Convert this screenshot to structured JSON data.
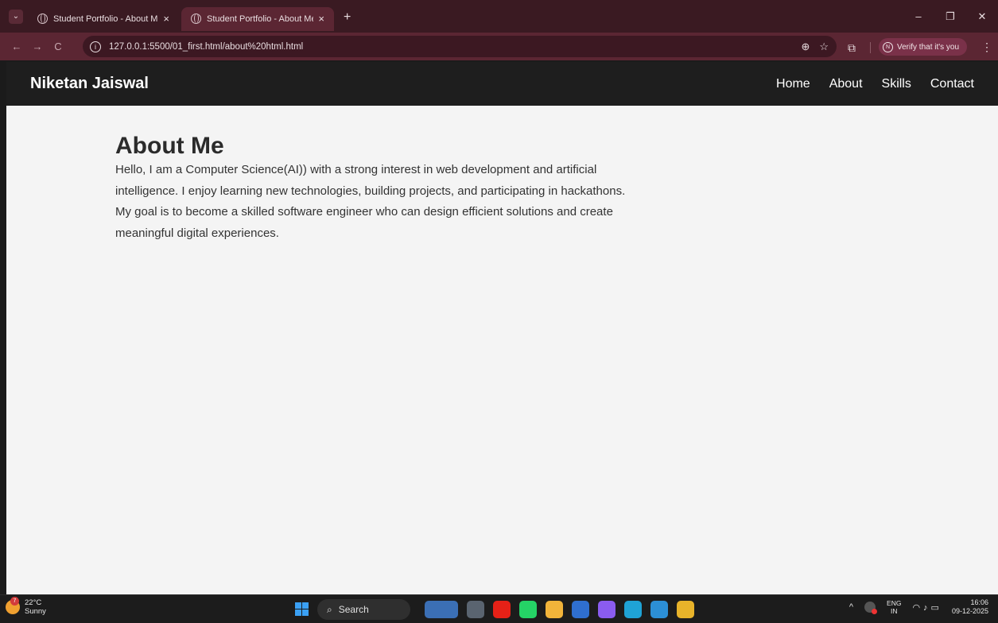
{
  "browser": {
    "tabs": [
      {
        "title": "Student Portfolio - About Me",
        "close": "×"
      },
      {
        "title": "Student Portfolio - About Me",
        "close": "×"
      }
    ],
    "new_tab": "+",
    "window": {
      "minimize": "–",
      "restore": "❐",
      "close": "✕"
    },
    "nav": {
      "back": "←",
      "forward": "→",
      "reload": "C"
    },
    "url": "127.0.0.1:5500/01_first.html/about%20html.html",
    "profile_initial": "N",
    "verify_label": "Verify that it's you",
    "menu": "⋮"
  },
  "site": {
    "brand": "Niketan Jaiswal",
    "nav_links": [
      "Home",
      "About",
      "Skills",
      "Contact"
    ]
  },
  "about": {
    "heading": "About Me",
    "paragraph_1": "Hello, I am a Computer Science(AI)) with a strong interest in web development and artificial intelligence. I enjoy learning new technologies, building projects, and participating in hackathons.",
    "paragraph_2": "My goal is to become a skilled software engineer who can design efficient solutions and create meaningful digital experiences."
  },
  "taskbar": {
    "weather_badge": "7",
    "temperature": "22°C",
    "condition": "Sunny",
    "search_label": "Search",
    "language_1": "ENG",
    "language_2": "IN",
    "time": "16:06",
    "date": "09-12-2025",
    "icons": [
      {
        "name": "news-widget-icon",
        "color": "#3b6fb5"
      },
      {
        "name": "file-explorer-app-icon",
        "color": "#5a6470"
      },
      {
        "name": "youtube-icon",
        "color": "#e62117"
      },
      {
        "name": "whatsapp-icon",
        "color": "#25d366"
      },
      {
        "name": "folder-icon",
        "color": "#f2b43a"
      },
      {
        "name": "store-icon",
        "color": "#2f6fd0"
      },
      {
        "name": "copilot-icon",
        "color": "#8a5cf0"
      },
      {
        "name": "edge-icon",
        "color": "#1fa3d6"
      },
      {
        "name": "vscode-icon",
        "color": "#2c8fd6"
      },
      {
        "name": "chrome-icon",
        "color": "#e8b32a"
      }
    ]
  }
}
